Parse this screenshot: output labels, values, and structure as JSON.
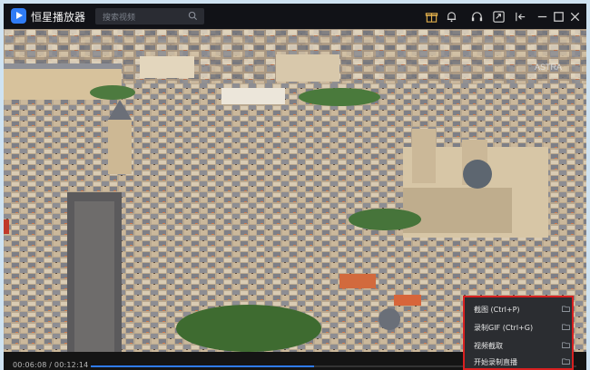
{
  "app": {
    "title": "恒星播放器"
  },
  "search": {
    "placeholder": "搜索视频"
  },
  "player": {
    "time_display": "00:06:08 / 00:12:14",
    "progress": 0.46
  },
  "context_menu": {
    "items": [
      {
        "label": "截图  (Ctrl+P)"
      },
      {
        "label": "录制GIF  (Ctrl+G)"
      },
      {
        "label": "视频截取"
      },
      {
        "label": "开始录制直播"
      }
    ]
  },
  "video_overlay": {
    "watermark": "ASTRA"
  },
  "colors": {
    "accent": "#2f7cf6",
    "highlight": "#d82020",
    "titlebar": "#111217"
  }
}
